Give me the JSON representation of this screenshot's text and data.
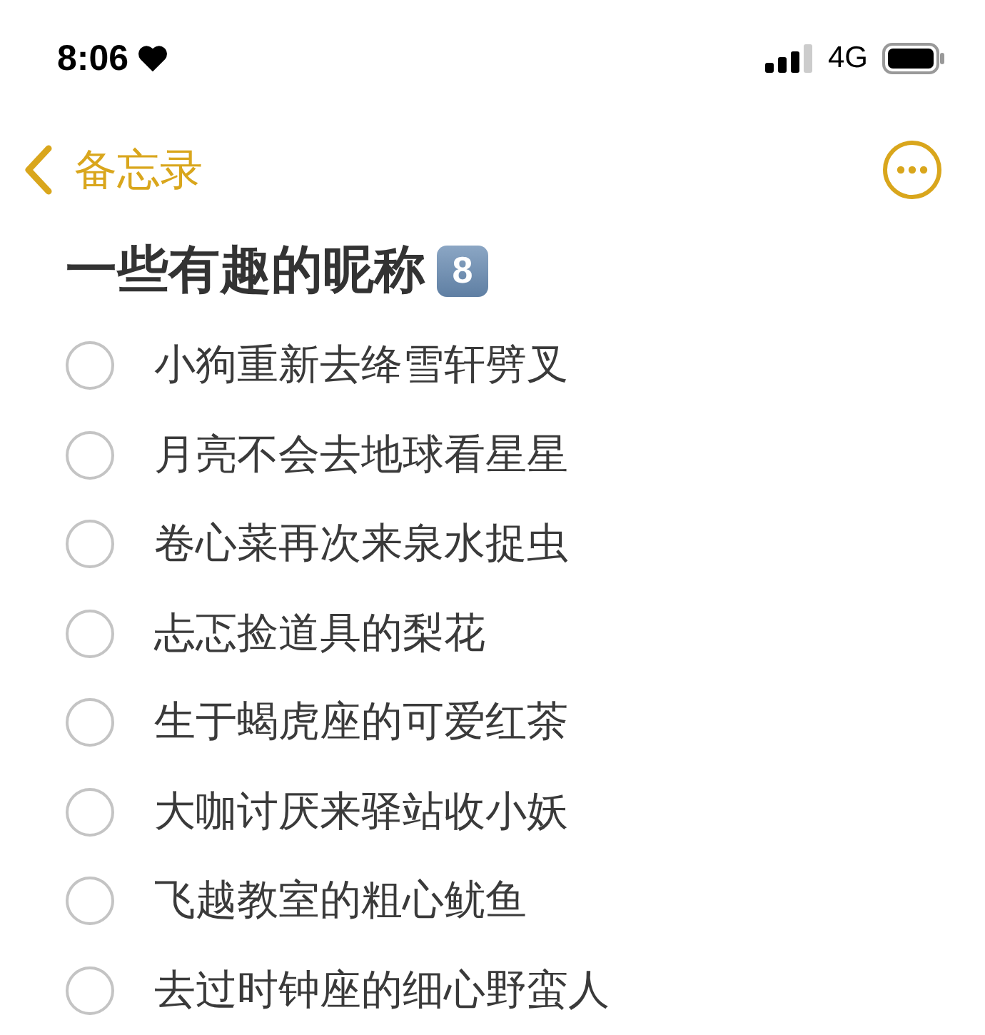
{
  "status_bar": {
    "time": "8:06",
    "network": "4G"
  },
  "nav": {
    "back_label": "备忘录"
  },
  "note": {
    "title": "一些有趣的昵称",
    "title_badge": "8",
    "items": [
      {
        "text": "小狗重新去绛雪轩劈叉",
        "checked": false
      },
      {
        "text": "月亮不会去地球看星星",
        "checked": false
      },
      {
        "text": "卷心菜再次来泉水捉虫",
        "checked": false
      },
      {
        "text": "忐忑捡道具的梨花",
        "checked": false
      },
      {
        "text": "生于蝎虎座的可爱红茶",
        "checked": false
      },
      {
        "text": "大咖讨厌来驿站收小妖",
        "checked": false
      },
      {
        "text": "飞越教室的粗心鱿鱼",
        "checked": false
      },
      {
        "text": "去过时钟座的细心野蛮人",
        "checked": false
      }
    ]
  }
}
